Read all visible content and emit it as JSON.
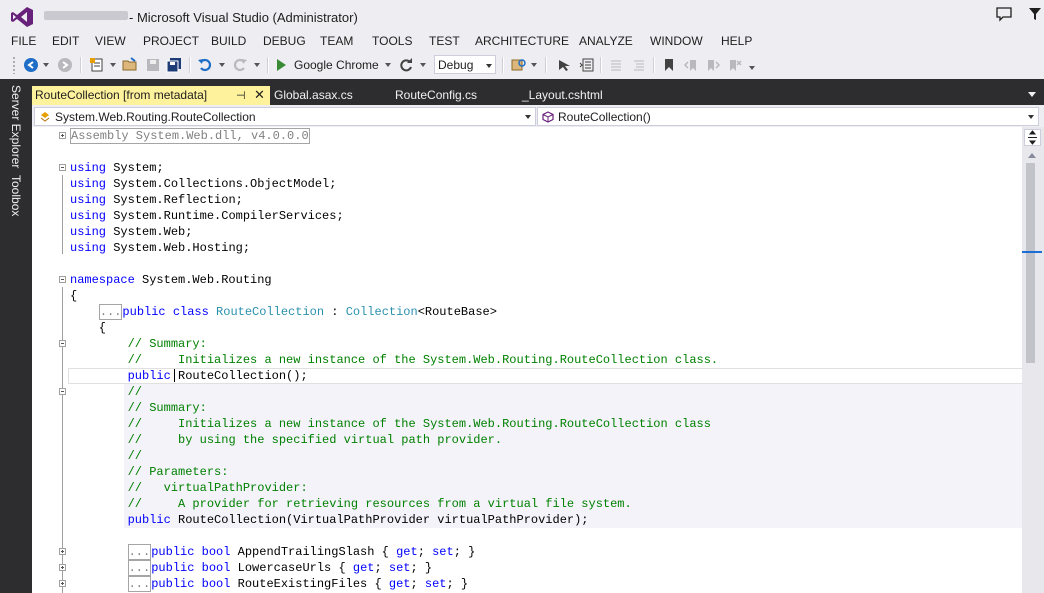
{
  "window": {
    "title": "- Microsoft Visual Studio (Administrator)"
  },
  "menu": [
    "FILE",
    "EDIT",
    "VIEW",
    "PROJECT",
    "BUILD",
    "DEBUG",
    "TEAM",
    "TOOLS",
    "TEST",
    "ARCHITECTURE",
    "ANALYZE",
    "WINDOW",
    "HELP"
  ],
  "toolbar": {
    "run_target": "Google Chrome",
    "configuration": "Debug"
  },
  "side_panels": [
    "Server Explorer",
    "Toolbox"
  ],
  "tabs": {
    "active": "RouteCollection [from metadata]",
    "others": [
      "Global.asax.cs",
      "RouteConfig.cs",
      "_Layout.cshtml"
    ]
  },
  "navigation": {
    "type": "System.Web.Routing.RouteCollection",
    "member": "RouteCollection()"
  },
  "code": {
    "assembly": "Assembly System.Web.dll, v4.0.0.0",
    "usings": [
      "System",
      "System.Collections.ObjectModel",
      "System.Reflection",
      "System.Runtime.CompilerServices",
      "System.Web",
      "System.Web.Hosting"
    ],
    "namespace": "System.Web.Routing",
    "class_name": "RouteCollection",
    "base_type": "Collection",
    "base_arg": "RouteBase",
    "summary1": "Initializes a new instance of the System.Web.Routing.RouteCollection class.",
    "ctor1": "RouteCollection();",
    "summary2a": "Initializes a new instance of the System.Web.Routing.RouteCollection class",
    "summary2b": "by using the specified virtual path provider.",
    "param_name": "virtualPathProvider:",
    "param_desc": "A provider for retrieving resources from a virtual file system.",
    "ctor2": "RouteCollection(VirtualPathProvider virtualPathProvider);",
    "properties": [
      "AppendTrailingSlash",
      "LowercaseUrls",
      "RouteExistingFiles"
    ]
  },
  "colors": {
    "keyword": "#0000ff",
    "type": "#2b91af",
    "comment": "#008000",
    "active_tab": "#fff29d",
    "vs_purple": "#68217a"
  }
}
